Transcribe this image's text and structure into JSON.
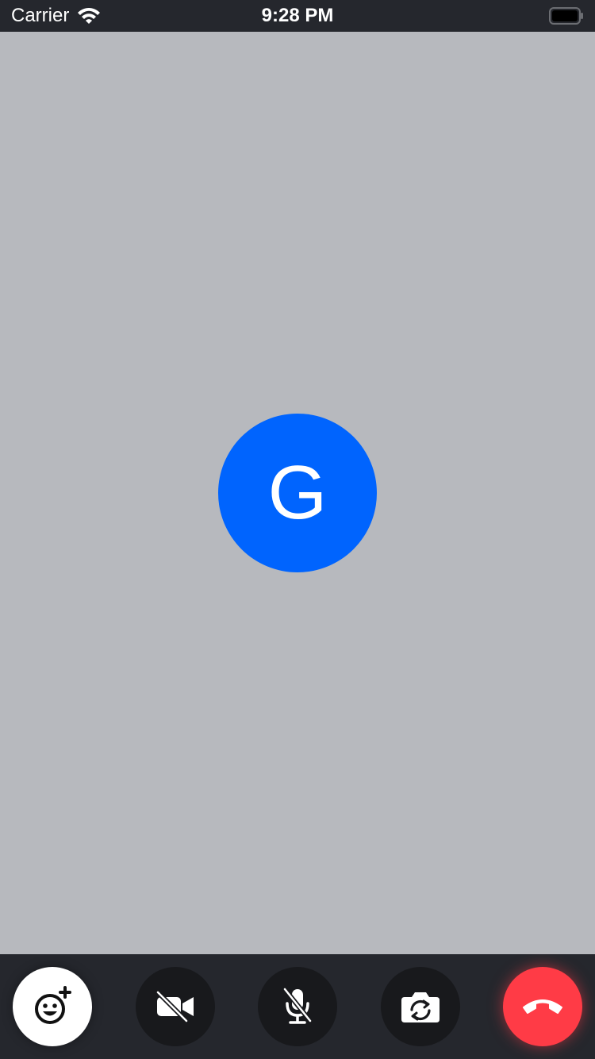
{
  "status_bar": {
    "carrier": "Carrier",
    "time": "9:28 PM",
    "icons": [
      "wifi-icon",
      "battery-icon"
    ]
  },
  "call": {
    "avatar_initial": "G",
    "avatar_color": "#0064FE",
    "stage_background": "#B7B9BE"
  },
  "controls": {
    "buttons": [
      {
        "icon": "emoji-add-icon",
        "state": "default"
      },
      {
        "icon": "video-off-icon",
        "state": "off"
      },
      {
        "icon": "mic-off-icon",
        "state": "off"
      },
      {
        "icon": "camera-flip-icon",
        "state": "default"
      },
      {
        "icon": "end-call-icon",
        "state": "default"
      }
    ],
    "bar_color": "#25272D",
    "end_color": "#FF3B46"
  }
}
